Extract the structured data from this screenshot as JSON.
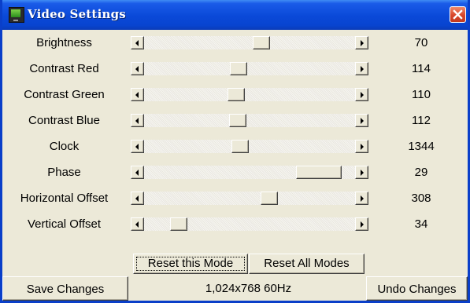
{
  "window": {
    "title": "Video Settings"
  },
  "settings": [
    {
      "label": "Brightness",
      "value": "70",
      "thumb_position": 0.56
    },
    {
      "label": "Contrast Red",
      "value": "114",
      "thumb_position": 0.445
    },
    {
      "label": "Contrast Green",
      "value": "110",
      "thumb_position": 0.43
    },
    {
      "label": "Contrast Blue",
      "value": "112",
      "thumb_position": 0.437
    },
    {
      "label": "Clock",
      "value": "1344",
      "thumb_position": 0.45
    },
    {
      "label": "Phase",
      "value": "29",
      "thumb_position": 0.92
    },
    {
      "label": "Horizontal Offset",
      "value": "308",
      "thumb_position": 0.6
    },
    {
      "label": "Vertical Offset",
      "value": "34",
      "thumb_position": 0.133
    }
  ],
  "mode_buttons": {
    "reset_this_mode": "Reset this Mode",
    "reset_all_modes": "Reset All Modes"
  },
  "footer": {
    "save_label": "Save Changes",
    "resolution": "1,024x768 60Hz",
    "undo_label": "Undo Changes"
  },
  "icons": {
    "app": "monitor-icon",
    "close": "close-icon",
    "left_arrow": "arrow-left-icon",
    "right_arrow": "arrow-right-icon"
  },
  "colors": {
    "titlebar": "#0a49d8",
    "window_bg": "#ece9d8",
    "close_button": "#d8462a"
  }
}
